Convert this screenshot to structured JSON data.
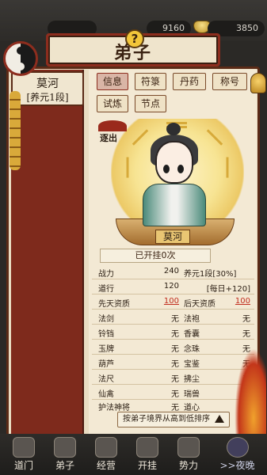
{
  "topbar": {
    "res_a": "",
    "res_b": "9160",
    "res_c": "3850"
  },
  "title": "弟子",
  "help_label": "?",
  "disciple_list": [
    {
      "name": "莫河",
      "rank": "[养元1段]"
    }
  ],
  "tabs": [
    {
      "label": "信息",
      "active": true
    },
    {
      "label": "符箓",
      "active": false
    },
    {
      "label": "丹药",
      "active": false
    },
    {
      "label": "称号",
      "active": false
    },
    {
      "label": "试炼",
      "active": false
    },
    {
      "label": "节点",
      "active": false
    }
  ],
  "portrait": {
    "expel_label": "逐出",
    "name_plaque": "莫河"
  },
  "afk_status": "已开挂0次",
  "stats": [
    {
      "k1": "战力",
      "v1": "240",
      "k2": "养元1段[30%]",
      "v2": "",
      "v1_link": false
    },
    {
      "k1": "道行",
      "v1": "120",
      "k2": "",
      "v2": "[每日+120]",
      "v1_link": false
    },
    {
      "k1": "先天资质",
      "v1": "100",
      "k2": "后天资质",
      "v2": "100",
      "v1_link": true,
      "v2_link": true
    },
    {
      "k1": "法剑",
      "v1": "无",
      "k2": "法袍",
      "v2": "无"
    },
    {
      "k1": "铃铛",
      "v1": "无",
      "k2": "香囊",
      "v2": "无"
    },
    {
      "k1": "玉牌",
      "v1": "无",
      "k2": "念珠",
      "v2": "无"
    },
    {
      "k1": "葫芦",
      "v1": "无",
      "k2": "宝鉴",
      "v2": "无"
    },
    {
      "k1": "法尺",
      "v1": "无",
      "k2": "拂尘",
      "v2": "无"
    },
    {
      "k1": "仙禽",
      "v1": "无",
      "k2": "瑞兽",
      "v2": "无"
    },
    {
      "k1": "护法神将",
      "v1": "无",
      "k2": "道心",
      "v2": "无"
    }
  ],
  "sort_button": "按弟子境界从高到低排序",
  "bottom_nav": [
    {
      "label": "道门",
      "icon": "temple-icon"
    },
    {
      "label": "弟子",
      "icon": "disciple-icon"
    },
    {
      "label": "经营",
      "icon": "shop-icon"
    },
    {
      "label": "开挂",
      "icon": "boost-icon"
    },
    {
      "label": "势力",
      "icon": "faction-icon"
    },
    {
      "label": ">>夜晚",
      "icon": "night-moon-icon"
    }
  ],
  "colors": {
    "accent_red": "#8d2d1e",
    "panel_bg": "#f3e9d4",
    "link_red": "#c12d1e"
  }
}
